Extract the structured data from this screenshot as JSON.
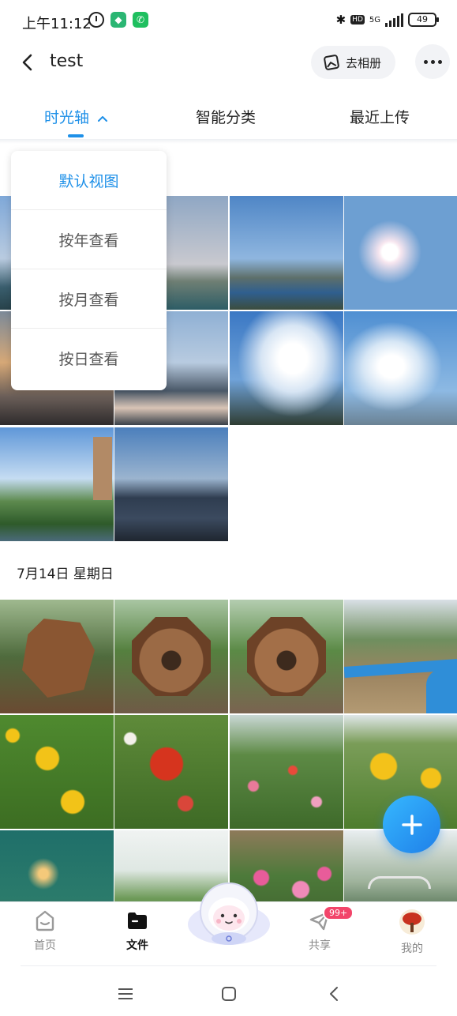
{
  "status_bar": {
    "time": "上午11:12",
    "network": "5G",
    "hd": "HD",
    "battery": "49"
  },
  "header": {
    "title": "test",
    "album_button": "去相册"
  },
  "tabs": [
    {
      "label": "时光轴",
      "active": true
    },
    {
      "label": "智能分类",
      "active": false
    },
    {
      "label": "最近上传",
      "active": false
    }
  ],
  "view_menu": {
    "items": [
      "默认视图",
      "按年查看",
      "按月查看",
      "按日查看"
    ],
    "selected_index": 0
  },
  "sections": [
    {
      "date_label": "",
      "photo_count": 11
    },
    {
      "date_label": "7月14日 星期日",
      "photo_count": 12
    }
  ],
  "bottom_nav": {
    "items": [
      {
        "label": "首页",
        "active": false
      },
      {
        "label": "文件",
        "active": true
      },
      {
        "label": "共享",
        "active": false,
        "badge": "99+"
      },
      {
        "label": "我的",
        "active": false
      }
    ]
  },
  "colors": {
    "accent": "#1e90e8",
    "badge": "#f2456a",
    "fab": "#2196f3"
  }
}
